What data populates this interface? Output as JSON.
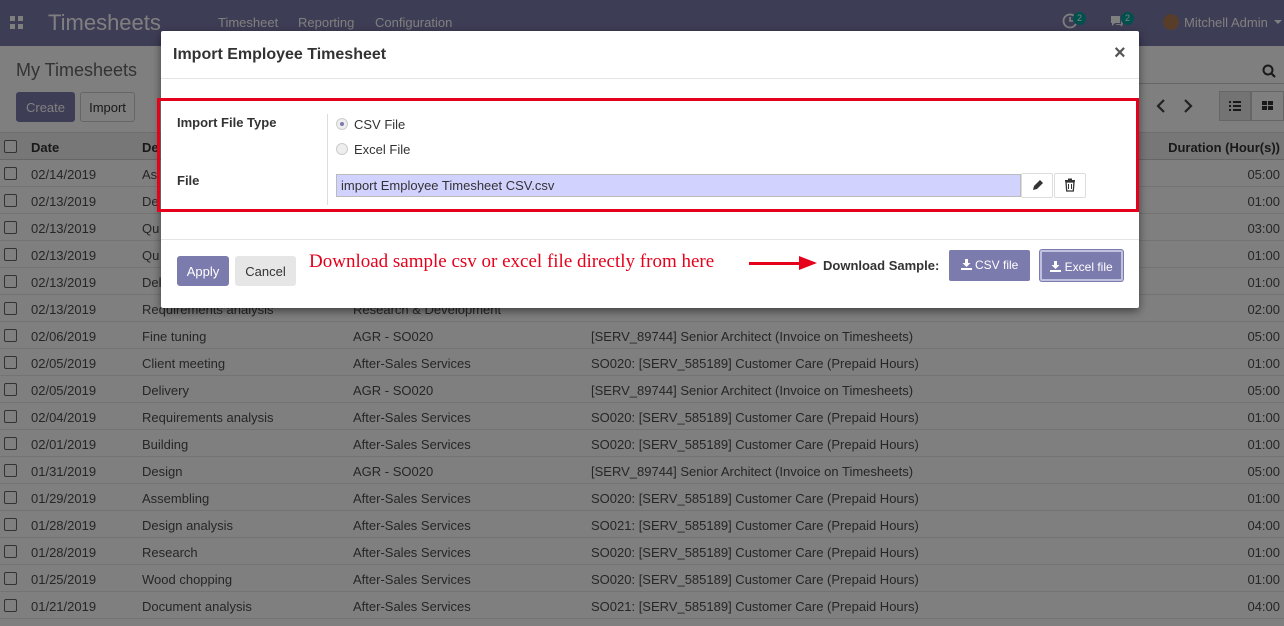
{
  "navbar": {
    "brand": "Timesheets",
    "menu": [
      "Timesheet",
      "Reporting",
      "Configuration"
    ],
    "activity_count": "2",
    "message_count": "2",
    "user_name": "Mitchell Admin"
  },
  "control_panel": {
    "title": "My Timesheets",
    "create_label": "Create",
    "import_label": "Import"
  },
  "table": {
    "headers": [
      "Date",
      "De",
      "Duration (Hour(s))"
    ],
    "rows": [
      {
        "date": "02/14/2019",
        "desc": "As",
        "project": "",
        "task": "",
        "duration": "05:00"
      },
      {
        "date": "02/13/2019",
        "desc": "De",
        "project": "",
        "task": "",
        "duration": "01:00"
      },
      {
        "date": "02/13/2019",
        "desc": "Qu",
        "project": "",
        "task": "",
        "duration": "03:00"
      },
      {
        "date": "02/13/2019",
        "desc": "Qu",
        "project": "",
        "task": "",
        "duration": "01:00"
      },
      {
        "date": "02/13/2019",
        "desc": "Del",
        "project": "",
        "task": "",
        "duration": "01:00"
      },
      {
        "date": "02/13/2019",
        "desc": "Requirements analysis",
        "project": "Research & Development",
        "task": "",
        "duration": "02:00"
      },
      {
        "date": "02/06/2019",
        "desc": "Fine tuning",
        "project": "AGR - SO020",
        "task": "[SERV_89744] Senior Architect (Invoice on Timesheets)",
        "duration": "05:00"
      },
      {
        "date": "02/05/2019",
        "desc": "Client meeting",
        "project": "After-Sales Services",
        "task": "SO020: [SERV_585189] Customer Care (Prepaid Hours)",
        "duration": "01:00"
      },
      {
        "date": "02/05/2019",
        "desc": "Delivery",
        "project": "AGR - SO020",
        "task": "[SERV_89744] Senior Architect (Invoice on Timesheets)",
        "duration": "05:00"
      },
      {
        "date": "02/04/2019",
        "desc": "Requirements analysis",
        "project": "After-Sales Services",
        "task": "SO020: [SERV_585189] Customer Care (Prepaid Hours)",
        "duration": "01:00"
      },
      {
        "date": "02/01/2019",
        "desc": "Building",
        "project": "After-Sales Services",
        "task": "SO020: [SERV_585189] Customer Care (Prepaid Hours)",
        "duration": "01:00"
      },
      {
        "date": "01/31/2019",
        "desc": "Design",
        "project": "AGR - SO020",
        "task": "[SERV_89744] Senior Architect (Invoice on Timesheets)",
        "duration": "05:00"
      },
      {
        "date": "01/29/2019",
        "desc": "Assembling",
        "project": "After-Sales Services",
        "task": "SO020: [SERV_585189] Customer Care (Prepaid Hours)",
        "duration": "01:00"
      },
      {
        "date": "01/28/2019",
        "desc": "Design analysis",
        "project": "After-Sales Services",
        "task": "SO021: [SERV_585189] Customer Care (Prepaid Hours)",
        "duration": "04:00"
      },
      {
        "date": "01/28/2019",
        "desc": "Research",
        "project": "After-Sales Services",
        "task": "SO020: [SERV_585189] Customer Care (Prepaid Hours)",
        "duration": "01:00"
      },
      {
        "date": "01/25/2019",
        "desc": "Wood chopping",
        "project": "After-Sales Services",
        "task": "SO020: [SERV_585189] Customer Care (Prepaid Hours)",
        "duration": "01:00"
      },
      {
        "date": "01/21/2019",
        "desc": "Document analysis",
        "project": "After-Sales Services",
        "task": "SO021: [SERV_585189] Customer Care (Prepaid Hours)",
        "duration": "04:00"
      }
    ]
  },
  "modal": {
    "title": "Import Employee Timesheet",
    "close_glyph": "×",
    "file_type_label": "Import File Type",
    "options": [
      "CSV File",
      "Excel File"
    ],
    "selected_option": "CSV File",
    "file_label": "File",
    "file_value": "import Employee Timesheet CSV.csv",
    "apply_label": "Apply",
    "cancel_label": "Cancel",
    "annotation": "Download sample csv or excel file directly from here",
    "download_label": "Download Sample:",
    "csv_button": "CSV file",
    "excel_button": "Excel file"
  },
  "colors": {
    "brand": "#7c7bad",
    "highlight": "#e5001c",
    "file_input_bg": "#d2d2ff"
  }
}
